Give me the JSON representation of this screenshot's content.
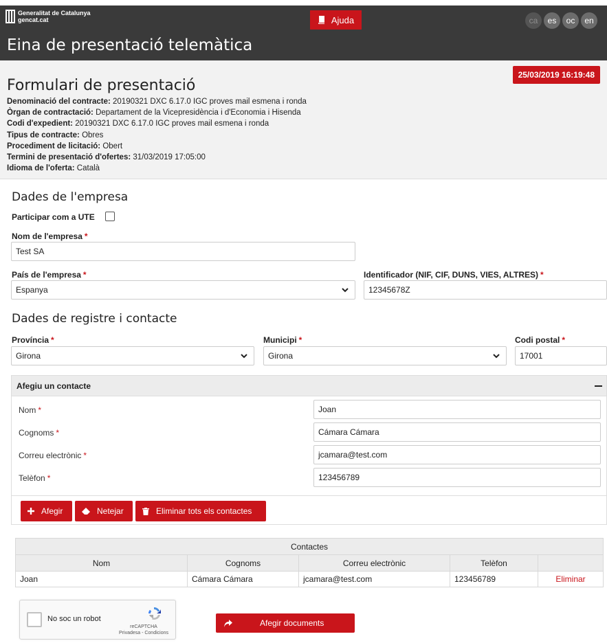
{
  "header": {
    "org_line1": "Generalitat de Catalunya",
    "org_line2": "gencat.cat",
    "help_label": "Ajuda",
    "languages": [
      "ca",
      "es",
      "oc",
      "en"
    ],
    "active_language": "ca",
    "app_title": "Eina de presentació telemàtica"
  },
  "summary": {
    "datetime": "25/03/2019 16:19:48",
    "title": "Formulari de presentació",
    "fields": [
      {
        "label": "Denominació del contracte:",
        "value": "20190321 DXC 6.17.0 IGC proves mail esmena i ronda"
      },
      {
        "label": "Òrgan de contractació:",
        "value": "Departament de la Vicepresidència i d'Economia i Hisenda"
      },
      {
        "label": "Codi d'expedient:",
        "value": "20190321 DXC 6.17.0 IGC proves mail esmena i ronda"
      },
      {
        "label": "Tipus de contracte:",
        "value": "Obres"
      },
      {
        "label": "Procediment de licitació:",
        "value": "Obert"
      },
      {
        "label": "Termini de presentació d'ofertes:",
        "value": "31/03/2019 17:05:00"
      },
      {
        "label": "Idioma de l'oferta:",
        "value": "Català"
      }
    ]
  },
  "company": {
    "section_title": "Dades de l'empresa",
    "ute_label": "Participar com a UTE",
    "ute_checked": false,
    "name_label": "Nom de l'empresa",
    "name_value": "Test SA",
    "country_label": "País de l'empresa",
    "country_value": "Espanya",
    "id_label": "Identificador (NIF, CIF, DUNS, VIES, ALTRES)",
    "id_value": "12345678Z",
    "required_mark": "*"
  },
  "registry": {
    "section_title": "Dades de registre i contacte",
    "province_label": "Província",
    "province_value": "Girona",
    "municipality_label": "Municipi",
    "municipality_value": "Girona",
    "postal_label": "Codi postal",
    "postal_value": "17001"
  },
  "contact_panel": {
    "title": "Afegiu un contacte",
    "fields": [
      {
        "label": "Nom",
        "value": "Joan"
      },
      {
        "label": "Cognoms",
        "value": "Cámara Cámara"
      },
      {
        "label": "Correu electrònic",
        "value": "jcamara@test.com"
      },
      {
        "label": "Telèfon",
        "value": "123456789"
      }
    ],
    "add_label": "Afegir",
    "clear_label": "Netejar",
    "delete_all_label": "Eliminar tots els contactes"
  },
  "contacts_table": {
    "caption": "Contactes",
    "columns": [
      "Nom",
      "Cognoms",
      "Correu electrònic",
      "Telèfon",
      ""
    ],
    "rows": [
      {
        "nom": "Joan",
        "cognoms": "Cámara Cámara",
        "email": "jcamara@test.com",
        "telefon": "123456789",
        "action": "Eliminar"
      }
    ]
  },
  "captcha": {
    "label": "No soc un robot",
    "brand": "reCAPTCHA",
    "links": "Privadesa - Condicions"
  },
  "footer": {
    "add_documents_label": "Afegir documents"
  },
  "colors": {
    "header_bg": "#3a3a3a",
    "accent_red": "#c9151b",
    "summary_bg": "#f2f2f2"
  }
}
